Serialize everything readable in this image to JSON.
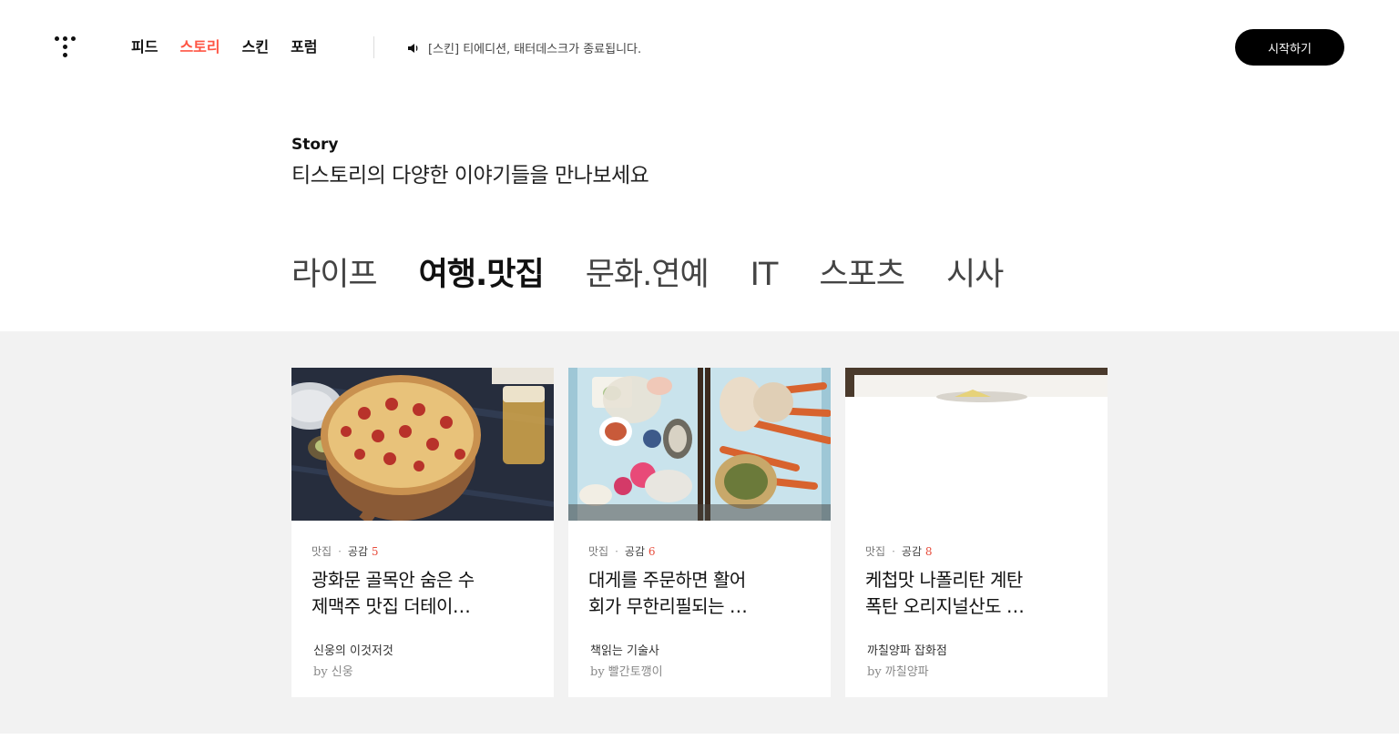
{
  "header": {
    "nav": [
      {
        "label": "피드",
        "active": false
      },
      {
        "label": "스토리",
        "active": true
      },
      {
        "label": "스킨",
        "active": false
      },
      {
        "label": "포럼",
        "active": false
      }
    ],
    "notice": "[스킨] 티에디션, 태터데스크가 종료됩니다.",
    "start_label": "시작하기"
  },
  "intro": {
    "label": "Story",
    "title": "티스토리의 다양한 이야기들을 만나보세요"
  },
  "tabs": [
    {
      "label": "라이프",
      "active": false
    },
    {
      "label": "여행.맛집",
      "active": true
    },
    {
      "label": "문화.연예",
      "active": false
    },
    {
      "label": "IT",
      "active": false
    },
    {
      "label": "스포츠",
      "active": false
    },
    {
      "label": "시사",
      "active": false
    }
  ],
  "colors": {
    "accent": "#ff5544",
    "likes": "#e74c3c",
    "section_bg": "#f2f2f2"
  },
  "cards": [
    {
      "category": "맛집",
      "likes_label": "공감",
      "likes": "5",
      "title_line1": "광화문 골목안 숨은 수",
      "title_line2": "제맥주 맛집 더테이…",
      "blog": "신웅의 이것저것",
      "author": "by 신웅",
      "image": "pizza-photo"
    },
    {
      "category": "맛집",
      "likes_label": "공감",
      "likes": "6",
      "title_line1": "대게를 주문하면 활어",
      "title_line2": "회가 무한리필되는 …",
      "blog": "책읽는 기술사",
      "author": "by 빨간토깽이",
      "image": "crab-platter-photo"
    },
    {
      "category": "맛집",
      "likes_label": "공감",
      "likes": "8",
      "title_line1": "케첩맛 나폴리탄 계탄",
      "title_line2": "폭탄 오리지널산도 …",
      "blog": "까칠양파 잡화점",
      "author": "by 까칠양파",
      "image": "sandwich-photo"
    }
  ]
}
